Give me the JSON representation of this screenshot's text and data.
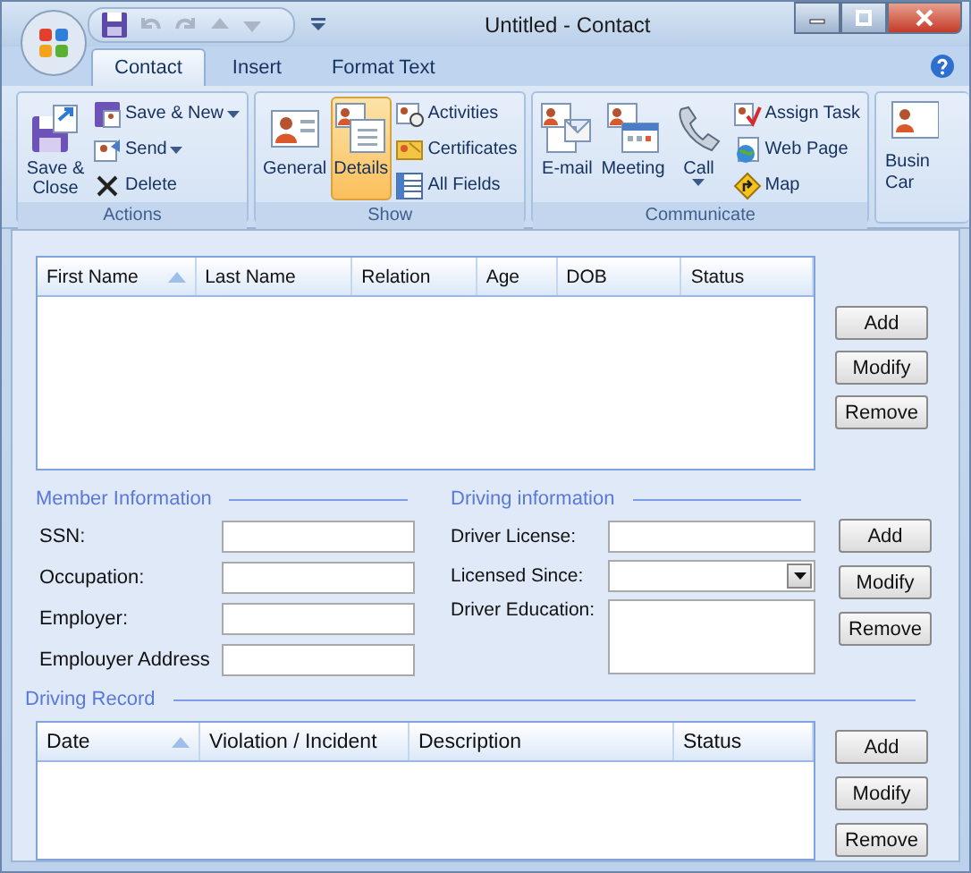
{
  "window": {
    "title": "Untitled - Contact"
  },
  "tabs": [
    {
      "label": "Contact",
      "selected": true
    },
    {
      "label": "Insert",
      "selected": false
    },
    {
      "label": "Format Text",
      "selected": false
    }
  ],
  "ribbon": {
    "groups": [
      {
        "label": "Actions",
        "large": [
          {
            "label": "Save & Close",
            "dropdown": false
          }
        ],
        "small": [
          {
            "label": "Save & New",
            "dropdown": true
          },
          {
            "label": "Send",
            "dropdown": true
          },
          {
            "label": "Delete",
            "dropdown": false
          }
        ]
      },
      {
        "label": "Show",
        "large": [
          {
            "label": "General",
            "selected": false
          },
          {
            "label": "Details",
            "selected": true
          }
        ],
        "small": [
          {
            "label": "Activities",
            "selected": false
          },
          {
            "label": "Certificates",
            "selected": false
          },
          {
            "label": "All Fields",
            "selected": false
          }
        ]
      },
      {
        "label": "Communicate",
        "large": [
          {
            "label": "E-mail",
            "dropdown": false
          },
          {
            "label": "Meeting",
            "dropdown": false
          },
          {
            "label": "Call",
            "dropdown": true
          }
        ],
        "small": [
          {
            "label": "Assign Task",
            "dropdown": false
          },
          {
            "label": "Web Page",
            "dropdown": false
          },
          {
            "label": "Map",
            "dropdown": false
          }
        ]
      }
    ],
    "partial_group": {
      "lines": [
        "Busin",
        "Car"
      ]
    }
  },
  "members": {
    "columns": [
      {
        "label": "First Name",
        "sorted": true
      },
      {
        "label": "Last Name",
        "sorted": false
      },
      {
        "label": "Relation",
        "sorted": false
      },
      {
        "label": "Age",
        "sorted": false
      },
      {
        "label": "DOB",
        "sorted": false
      },
      {
        "label": "Status",
        "sorted": false
      }
    ],
    "buttons": [
      "Add",
      "Modify",
      "Remove"
    ]
  },
  "member_information": {
    "title": "Member Information",
    "fields": [
      {
        "label": "SSN:"
      },
      {
        "label": "Occupation:"
      },
      {
        "label": "Employer:"
      },
      {
        "label": "Emplouyer Address"
      }
    ]
  },
  "driving_information": {
    "title": "Driving information",
    "fields": [
      {
        "label": "Driver License:",
        "kind": "text"
      },
      {
        "label": "Licensed Since:",
        "kind": "dropdown"
      },
      {
        "label": "Driver Education:",
        "kind": "textarea"
      }
    ],
    "buttons": [
      "Add",
      "Modify",
      "Remove"
    ]
  },
  "driving_record": {
    "title": "Driving Record",
    "columns": [
      {
        "label": "Date",
        "sorted": true
      },
      {
        "label": "Violation / Incident",
        "sorted": false
      },
      {
        "label": "Description",
        "sorted": false
      },
      {
        "label": "Status",
        "sorted": false
      }
    ],
    "buttons": [
      "Add",
      "Modify",
      "Remove"
    ]
  }
}
